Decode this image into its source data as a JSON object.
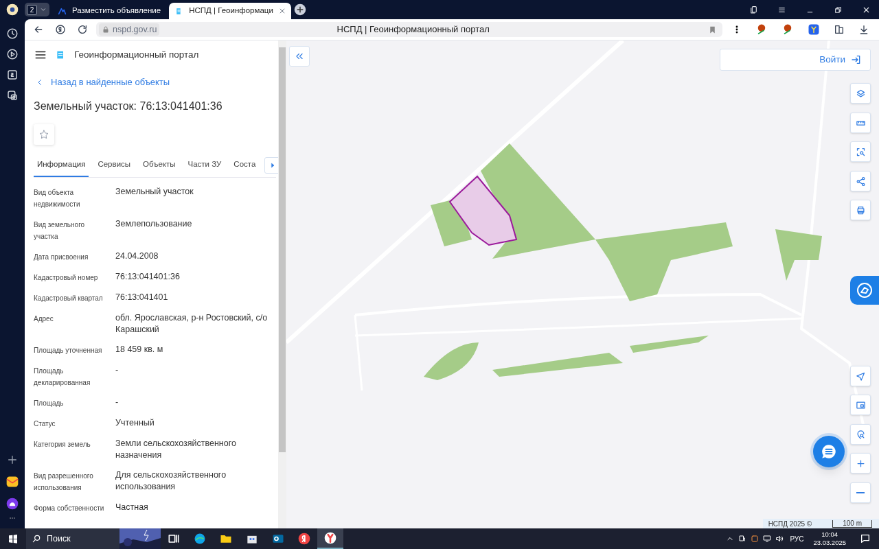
{
  "browser": {
    "tab_count": "2",
    "tabs": [
      {
        "title": "Разместить объявление",
        "selected": false
      },
      {
        "title": "НСПД | Геоинформаци",
        "selected": true
      }
    ],
    "address": "nspd.gov.ru",
    "page_title": "НСПД | Геоинформационный портал"
  },
  "panel": {
    "portal_title": "Геоинформационный портал",
    "back_link": "Назад в найденные объекты",
    "heading": "Земельный участок: 76:13:041401:36",
    "tabs": [
      {
        "label": "Информация",
        "selected": true
      },
      {
        "label": "Сервисы",
        "selected": false
      },
      {
        "label": "Объекты",
        "selected": false
      },
      {
        "label": "Части ЗУ",
        "selected": false
      },
      {
        "label": "Соста",
        "selected": false
      }
    ],
    "fields": [
      {
        "label": "Вид объекта недвижимости",
        "value": "Земельный участок"
      },
      {
        "label": "Вид земельного участка",
        "value": "Землепользование"
      },
      {
        "label": "Дата присвоения",
        "value": "24.04.2008"
      },
      {
        "label": "Кадастровый номер",
        "value": "76:13:041401:36"
      },
      {
        "label": "Кадастровый квартал",
        "value": "76:13:041401"
      },
      {
        "label": "Адрес",
        "value": "обл. Ярославская, р-н Ростовский, с/о Карашский"
      },
      {
        "label": "Площадь уточненная",
        "value": "18 459 кв. м"
      },
      {
        "label": "Площадь декларированная",
        "value": "-"
      },
      {
        "label": "Площадь",
        "value": "-"
      },
      {
        "label": "Статус",
        "value": "Учтенный"
      },
      {
        "label": "Категория земель",
        "value": "Земли сельскохозяйственного назначения"
      },
      {
        "label": "Вид разрешенного использования",
        "value": "Для сельскохозяйственного использования"
      },
      {
        "label": "Форма собственности",
        "value": "Частная"
      }
    ]
  },
  "map": {
    "login": "Войти",
    "attribution": "НСПД 2025 ©",
    "scale": "100 m"
  },
  "taskbar": {
    "search": "Поиск",
    "language": "РУС",
    "time": "10:04",
    "date": "23.03.2025"
  }
}
